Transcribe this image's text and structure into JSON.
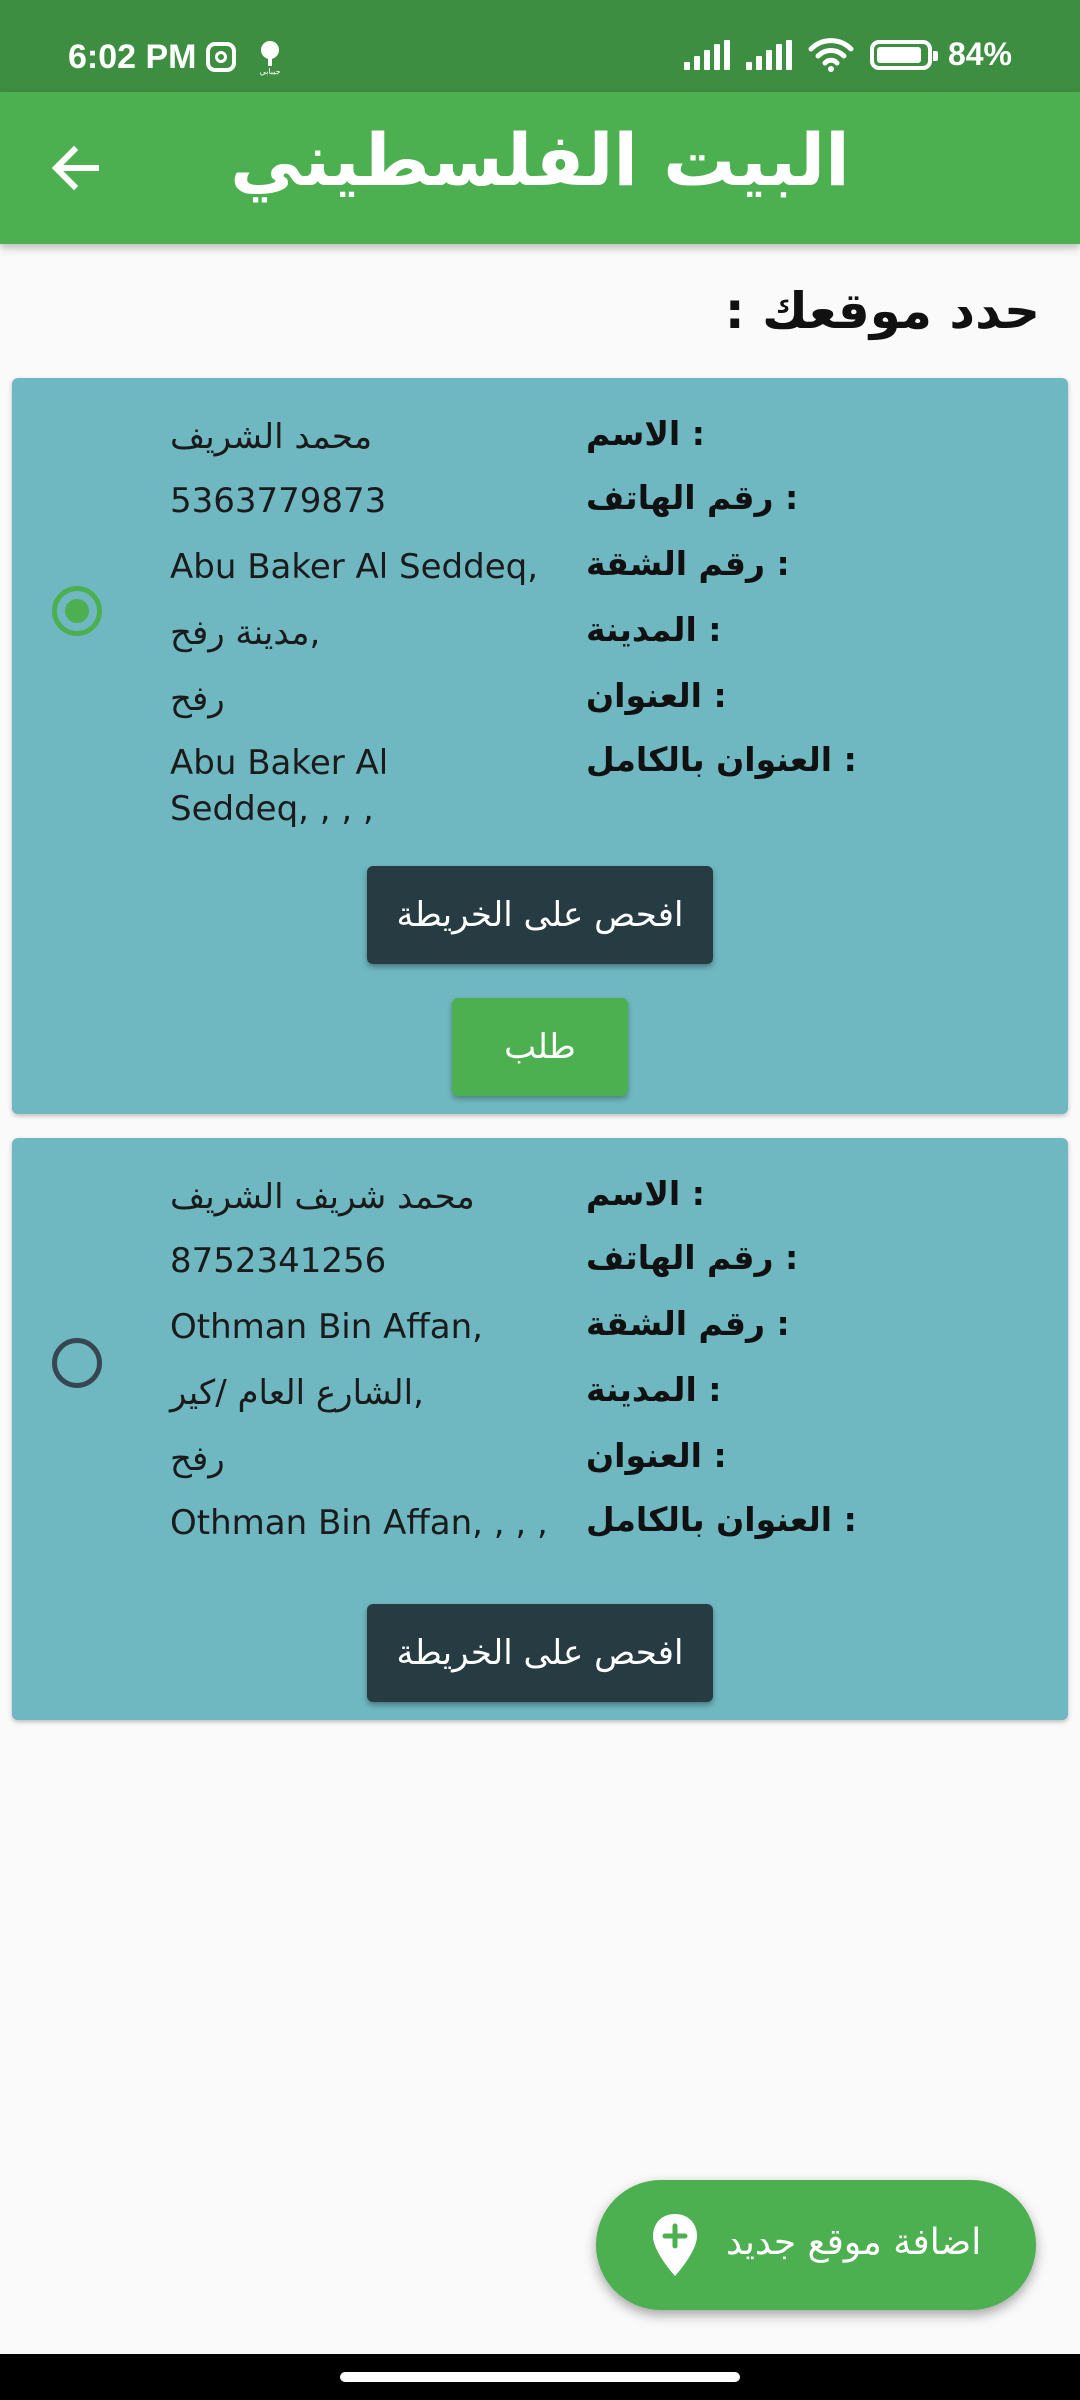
{
  "status_bar": {
    "time": "6:02 PM",
    "battery_text": "84%",
    "battery_level": 84,
    "app_badge_text": "جيبابي",
    "icons": [
      "instagram-icon",
      "app-notification-icon",
      "signal-icon",
      "signal-icon",
      "wifi-icon",
      "battery-icon"
    ]
  },
  "app_bar": {
    "title": "البيت الفلسطيني",
    "back_icon": "arrow-left-icon"
  },
  "section": {
    "title": "حدد موقعك :"
  },
  "labels": {
    "name": "الاسم :",
    "phone": "رقم الهاتف :",
    "apartment": "رقم الشقة :",
    "city": "المدينة :",
    "address": "العنوان :",
    "full_address": "العنوان بالكامل :"
  },
  "addresses": [
    {
      "selected": true,
      "name": "محمد الشريف",
      "phone": "5363779873",
      "apartment": "Abu Baker Al Seddeq,",
      "city": "مدينة رفح,",
      "address": "رفح",
      "full_address": "Abu Baker Al Seddeq,  , ,  ,",
      "map_button": "افحص على الخريطة",
      "order_button": "طلب"
    },
    {
      "selected": false,
      "name": "محمد شريف الشريف",
      "phone": "8752341256",
      "apartment": "Othman Bin Affan,",
      "city": "الشارع العام /كير,",
      "address": "رفح",
      "full_address": "Othman Bin Affan,  , ,  ,",
      "map_button": "افحص على الخريطة"
    }
  ],
  "fab": {
    "label": "اضافة موقع جديد",
    "icon": "add-location-icon"
  },
  "colors": {
    "status_bar": "#3e8e41",
    "app_bar": "#4caf50",
    "card": "#6fb8c2",
    "map_button": "#263c42",
    "accent": "#4caf50"
  }
}
